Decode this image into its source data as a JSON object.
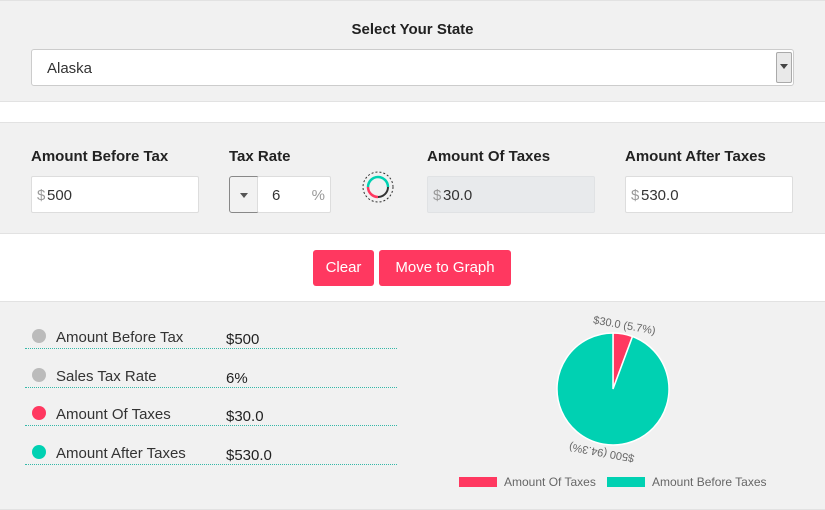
{
  "state": {
    "title": "Select Your State",
    "selected": "Alaska"
  },
  "calculator": {
    "amount_before_tax_label": "Amount Before Tax",
    "amount_before_tax_currency": "$",
    "amount_before_tax_value": "500",
    "tax_rate_label": "Tax Rate",
    "tax_rate_value": "6",
    "tax_rate_unit": "%",
    "amount_of_taxes_label": "Amount Of Taxes",
    "amount_of_taxes_currency": "$",
    "amount_of_taxes_value": "30.0",
    "amount_after_taxes_label": "Amount After Taxes",
    "amount_after_taxes_currency": "$",
    "amount_after_taxes_value": "530.0"
  },
  "buttons": {
    "clear_label": "Clear",
    "graph_label": "Move to Graph"
  },
  "results": [
    {
      "label": "Amount Before Tax",
      "value": "$500",
      "color": "#bbbbbb"
    },
    {
      "label": "Sales Tax Rate",
      "value": "6%",
      "color": "#bbbbbb"
    },
    {
      "label": "Amount Of Taxes",
      "value": "$30.0",
      "color": "#ff3860"
    },
    {
      "label": "Amount After Taxes",
      "value": "$530.0",
      "color": "#00d1b2"
    }
  ],
  "colors": {
    "accent": "#ff3860",
    "teal": "#00d1b2",
    "panel_bg": "#f1f1f1"
  },
  "chart_data": {
    "type": "pie",
    "series": [
      {
        "name": "Amount Of Taxes",
        "value": 30.0,
        "label": "$30.0 (5.7%)",
        "color": "#ff3860"
      },
      {
        "name": "Amount Before Taxes",
        "value": 500,
        "label": "$500 (94.3%)",
        "color": "#00d1b2"
      }
    ],
    "legend_position": "bottom"
  }
}
